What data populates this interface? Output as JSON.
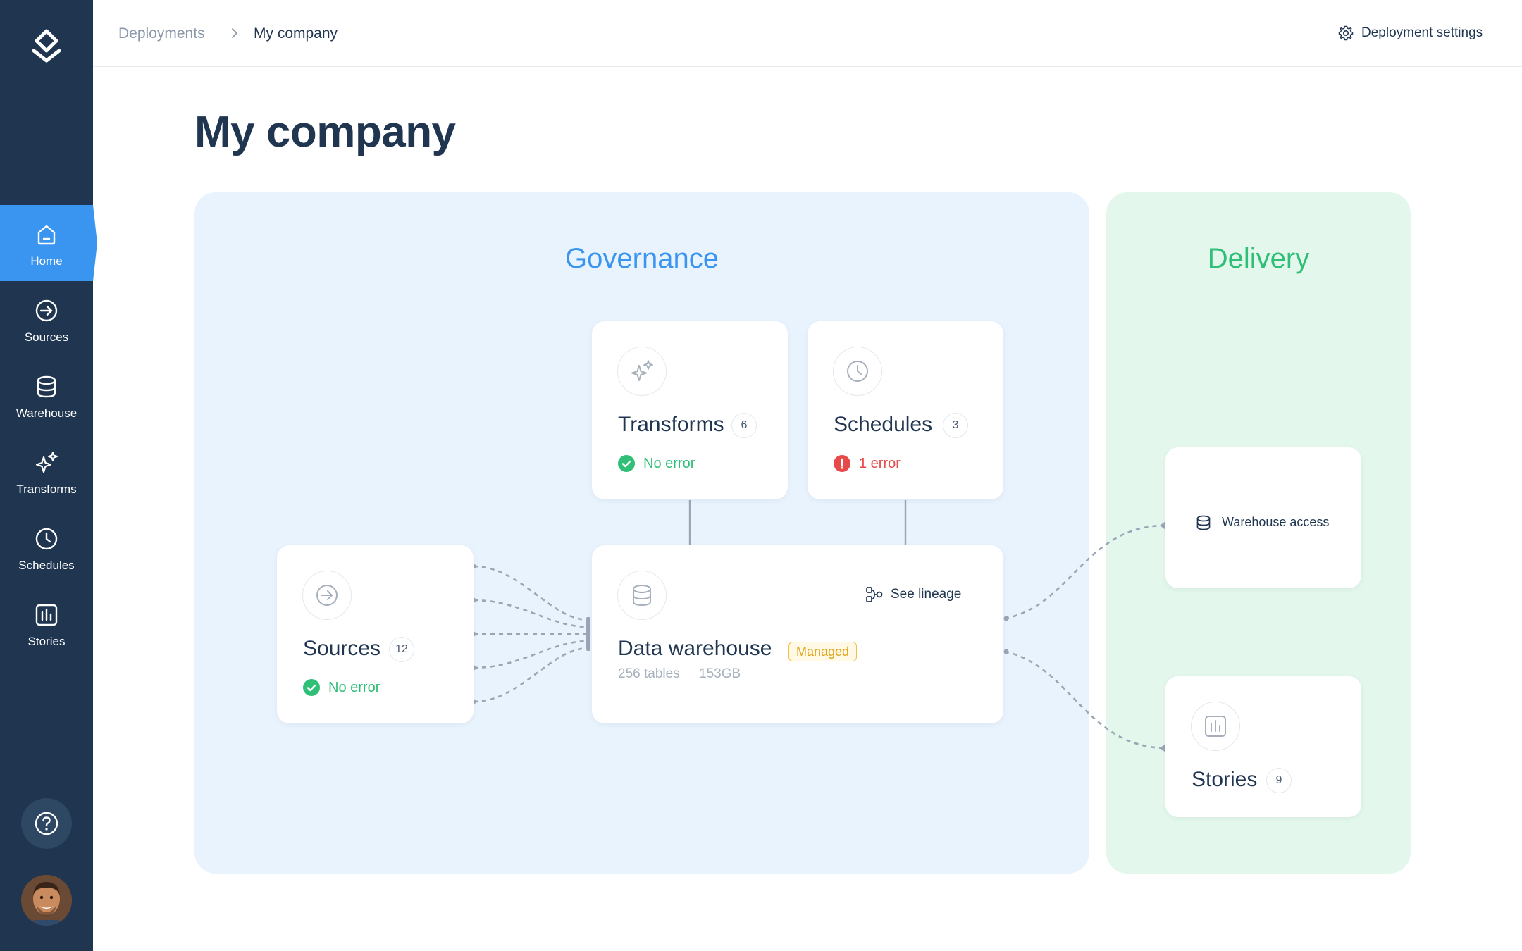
{
  "sidebar": {
    "logo": "logo-icon",
    "items": [
      {
        "label": "Home",
        "icon": "home-icon",
        "active": true
      },
      {
        "label": "Sources",
        "icon": "sources-icon"
      },
      {
        "label": "Warehouse",
        "icon": "database-icon"
      },
      {
        "label": "Transforms",
        "icon": "sparkles-icon"
      },
      {
        "label": "Schedules",
        "icon": "clock-icon"
      },
      {
        "label": "Stories",
        "icon": "bar-chart-icon"
      }
    ],
    "help_icon": "help-icon",
    "avatar": "user-avatar"
  },
  "header": {
    "breadcrumb": [
      "Deployments",
      "My company"
    ],
    "settings_label": "Deployment settings"
  },
  "page": {
    "title": "My company"
  },
  "governance": {
    "title": "Governance",
    "transforms": {
      "title": "Transforms",
      "count": "6",
      "status": "No error"
    },
    "schedules": {
      "title": "Schedules",
      "count": "3",
      "status": "1 error"
    },
    "sources": {
      "title": "Sources",
      "count": "12",
      "status": "No error"
    },
    "warehouse": {
      "title": "Data warehouse",
      "badge": "Managed",
      "tables": "256 tables",
      "size": "153GB",
      "lineage_label": "See lineage"
    }
  },
  "delivery": {
    "title": "Delivery",
    "warehouse_access": {
      "label": "Warehouse access"
    },
    "stories": {
      "title": "Stories",
      "count": "9"
    }
  },
  "colors": {
    "sidebar": "#1f3550",
    "accent": "#3a95f0",
    "success": "#2fbf77",
    "error": "#e84a4a",
    "managed": "#f2c23e",
    "governance_bg": "#e9f3fd",
    "delivery_bg": "#e3f7ec"
  }
}
